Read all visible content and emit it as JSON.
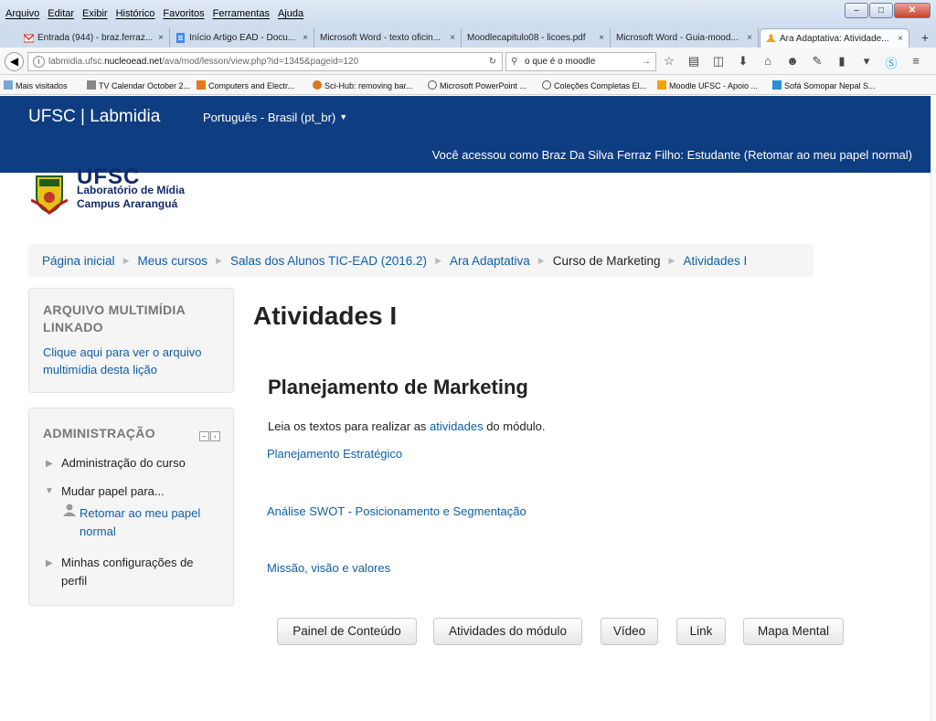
{
  "browser": {
    "menu": [
      "Arquivo",
      "Editar",
      "Exibir",
      "Histórico",
      "Favoritos",
      "Ferramentas",
      "Ajuda"
    ],
    "tabs": [
      {
        "label": "Entrada (944) - braz.ferraz...",
        "icon": "gmail-icon",
        "color": "#d93025"
      },
      {
        "label": "Início Artigo EAD - Docu...",
        "icon": "docs-icon",
        "color": "#4285f4"
      },
      {
        "label": "Microsoft Word - texto oficin...",
        "icon": "",
        "color": ""
      },
      {
        "label": "Moodlecapitulo08 - licoes.pdf",
        "icon": "",
        "color": ""
      },
      {
        "label": "Microsoft Word - Guia-mood...",
        "icon": "",
        "color": ""
      },
      {
        "label": "Ara Adaptativa: Atividade...",
        "icon": "moodle-icon",
        "color": "#f0a30a"
      }
    ],
    "tab_close": "×",
    "new_tab": "+",
    "url_prefix": "labmidia.ufsc.",
    "url_domain": "nucleoead.net",
    "url_suffix": "/ava/mod/lesson/view.php?id=1345&pageid=120",
    "search_value": "o que é o moodle",
    "bookmarks": [
      "Mais visitados",
      "TV Calendar October 2...",
      "Computers and Electr...",
      "Sci-Hub: removing bar...",
      "Microsoft PowerPoint ...",
      "Coleções Completas El...",
      "Moodle UFSC - Apoio ...",
      "Sofá Somopar Nepal S..."
    ]
  },
  "header": {
    "brand": "UFSC | Labmidia",
    "language": "Português - Brasil (pt_br)",
    "user_message": "Você acessou como Braz Da Silva Ferraz Filho: Estudante (Retomar ao meu papel normal)"
  },
  "logo": {
    "name": "UFSC",
    "line1": "Laboratório de Mídia",
    "line2": "Campus Araranguá"
  },
  "breadcrumb": [
    "Página inicial",
    "Meus cursos",
    "Salas dos Alunos TIC-EAD (2016.2)",
    "Ara Adaptativa",
    "Curso de Marketing",
    "Atividades I"
  ],
  "block_media": {
    "title_line1": "ARQUIVO MULTIMÍDIA",
    "title_line2": "LINKADO",
    "link_line1": "Clique aqui para ver o arquivo",
    "link_line2": "multimídia desta lição"
  },
  "block_admin": {
    "title": "ADMINISTRAÇÃO",
    "course_admin": "Administração do curso",
    "switch_role": "Mudar papel para...",
    "return_line1": "Retomar ao meu papel",
    "return_line2": "normal",
    "profile_line1": "Minhas configurações de",
    "profile_line2": "perfil"
  },
  "main": {
    "title": "Atividades I",
    "subtitle": "Planejamento de Marketing",
    "intro_before": "Leia os textos para realizar as ",
    "intro_link": "atividades",
    "intro_after": " do módulo.",
    "links": [
      "Planejamento Estratégico",
      "Análise SWOT - Posicionamento e Segmentação",
      "Missão, visão e valores"
    ],
    "buttons": [
      "Painel de Conteúdo",
      "Atividades do módulo",
      "Vídeo",
      "Link",
      "Mapa Mental"
    ]
  },
  "colors": {
    "navbar": "#0f3d82",
    "link": "#0e5fa8"
  }
}
